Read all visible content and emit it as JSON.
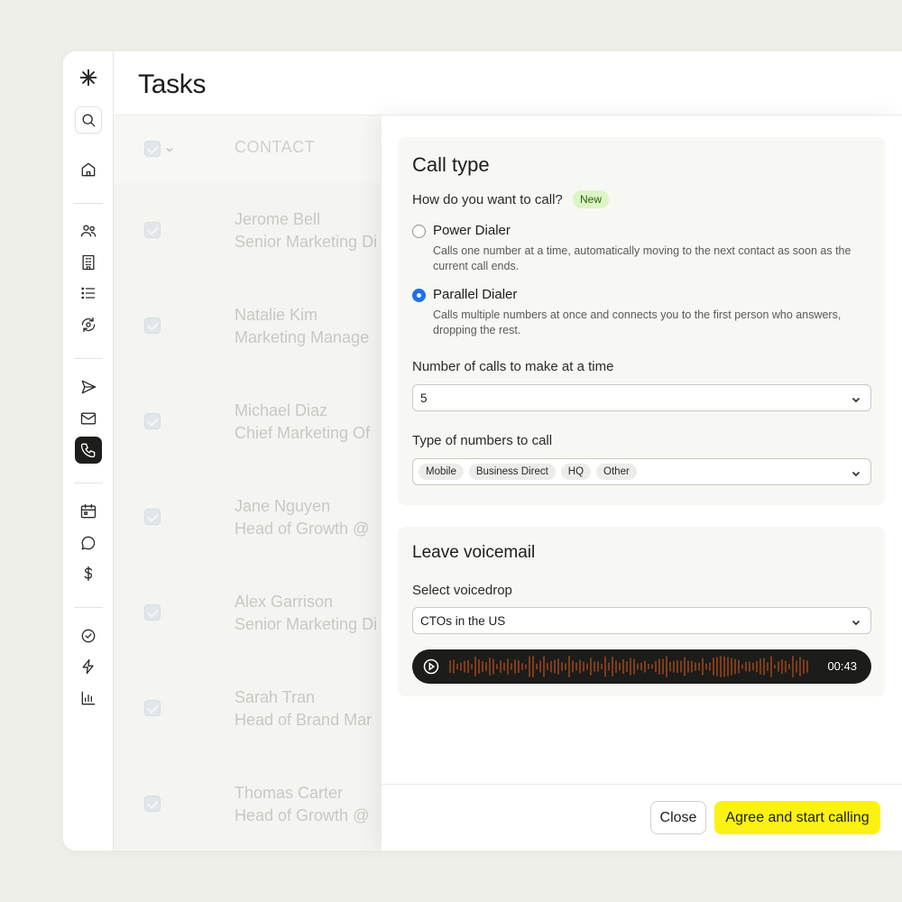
{
  "page": {
    "title": "Tasks"
  },
  "sidebar": {
    "icons": [
      "logo-asterisk-icon",
      "search-icon",
      "home-icon",
      "people-icon",
      "building-icon",
      "list-icon",
      "sync-icon",
      "send-icon",
      "mail-icon",
      "phone-icon",
      "calendar-icon",
      "chat-icon",
      "dollar-icon",
      "check-circle-icon",
      "bolt-icon",
      "chart-icon"
    ],
    "active": "phone-icon"
  },
  "table": {
    "header": "CONTACT",
    "rows": [
      {
        "name": "Jerome Bell",
        "role": "Senior Marketing Di"
      },
      {
        "name": "Natalie Kim",
        "role": "Marketing Manage"
      },
      {
        "name": "Michael Diaz",
        "role": "Chief Marketing Of"
      },
      {
        "name": "Jane Nguyen",
        "role": "Head of Growth @"
      },
      {
        "name": "Alex Garrison",
        "role": "Senior Marketing Di"
      },
      {
        "name": "Sarah Tran",
        "role": "Head of Brand Mar"
      },
      {
        "name": "Thomas Carter",
        "role": "Head of Growth @"
      }
    ]
  },
  "panel": {
    "call_type": {
      "title": "Call type",
      "question": "How do you want to call?",
      "badge": "New",
      "options": [
        {
          "title": "Power Dialer",
          "desc": "Calls one number at a time, automatically moving to the next contact as soon as the current call ends.",
          "selected": false
        },
        {
          "title": "Parallel Dialer",
          "desc": "Calls multiple numbers at once and connects you to the first person who answers, dropping the rest.",
          "selected": true
        }
      ],
      "calls_label": "Number of calls to make at a time",
      "calls_value": "5",
      "numbers_label": "Type of numbers to call",
      "number_types": [
        "Mobile",
        "Business Direct",
        "HQ",
        "Other"
      ]
    },
    "voicemail": {
      "title": "Leave voicemail",
      "select_label": "Select voicedrop",
      "select_value": "CTOs in the US",
      "duration": "00:43"
    },
    "footer": {
      "close_label": "Close",
      "primary_label": "Agree and start calling"
    }
  },
  "colors": {
    "accent": "#fbf213",
    "radio": "#1f6ff2",
    "waveform": "#c0531c",
    "badge_bg": "#dcf5c4"
  }
}
